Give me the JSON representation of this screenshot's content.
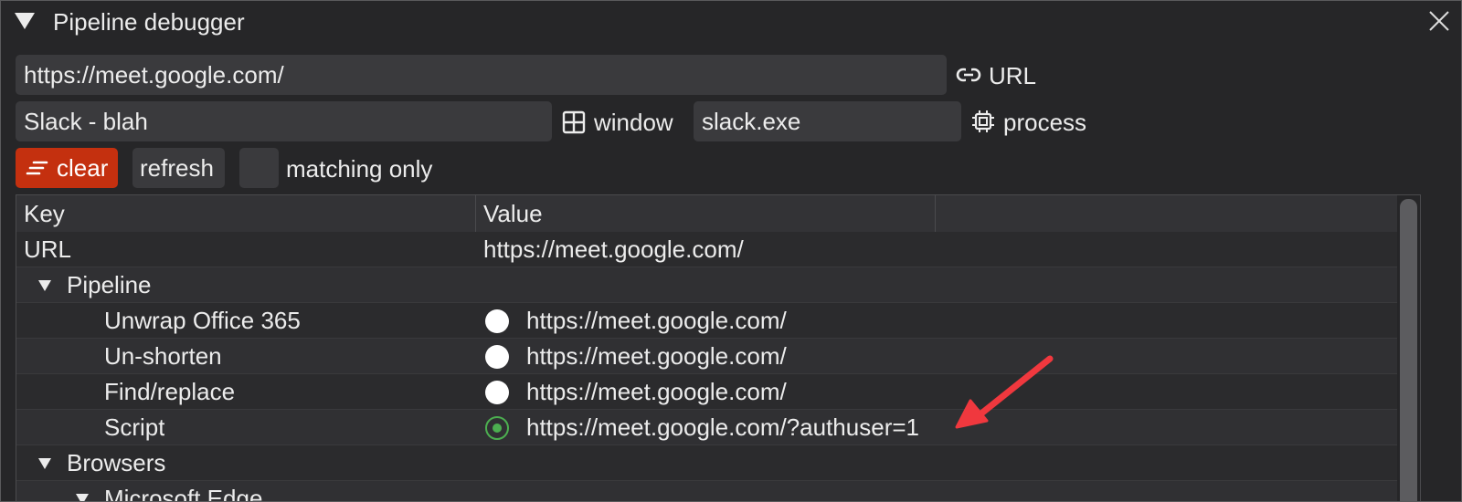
{
  "window": {
    "title": "Pipeline debugger"
  },
  "inputs": {
    "url": {
      "value": "https://meet.google.com/",
      "label": "URL",
      "icon": "link-icon"
    },
    "window": {
      "value": "Slack - blah",
      "label": "window",
      "icon": "window-grid-icon"
    },
    "process": {
      "value": "slack.exe",
      "label": "process",
      "icon": "cpu-chip-icon"
    }
  },
  "toolbar": {
    "clear_label": "clear",
    "refresh_label": "refresh",
    "matching_only_label": "matching only",
    "matching_only_checked": false
  },
  "table": {
    "columns": [
      "Key",
      "Value",
      ""
    ],
    "rows": [
      {
        "key": "URL",
        "value": "https://meet.google.com/",
        "type": "plain"
      },
      {
        "key": "Pipeline",
        "value": "",
        "type": "group",
        "expanded": true
      },
      {
        "key": "Unwrap Office 365",
        "value": "https://meet.google.com/",
        "type": "step",
        "status": "unchanged"
      },
      {
        "key": "Un-shorten",
        "value": "https://meet.google.com/",
        "type": "step",
        "status": "unchanged"
      },
      {
        "key": "Find/replace",
        "value": "https://meet.google.com/",
        "type": "step",
        "status": "unchanged"
      },
      {
        "key": "Script",
        "value": "https://meet.google.com/?authuser=1",
        "type": "step",
        "status": "changed"
      },
      {
        "key": "Browsers",
        "value": "",
        "type": "group",
        "expanded": true
      },
      {
        "key": "Microsoft Edge",
        "value": "",
        "type": "subgroup",
        "expanded": true
      }
    ]
  },
  "colors": {
    "background": "#262628",
    "field_bg": "#3a3a3d",
    "clear_button": "#c4300f",
    "status_changed": "#4caf50",
    "status_unchanged": "#ffffff",
    "annotation_arrow": "#f0383e"
  }
}
